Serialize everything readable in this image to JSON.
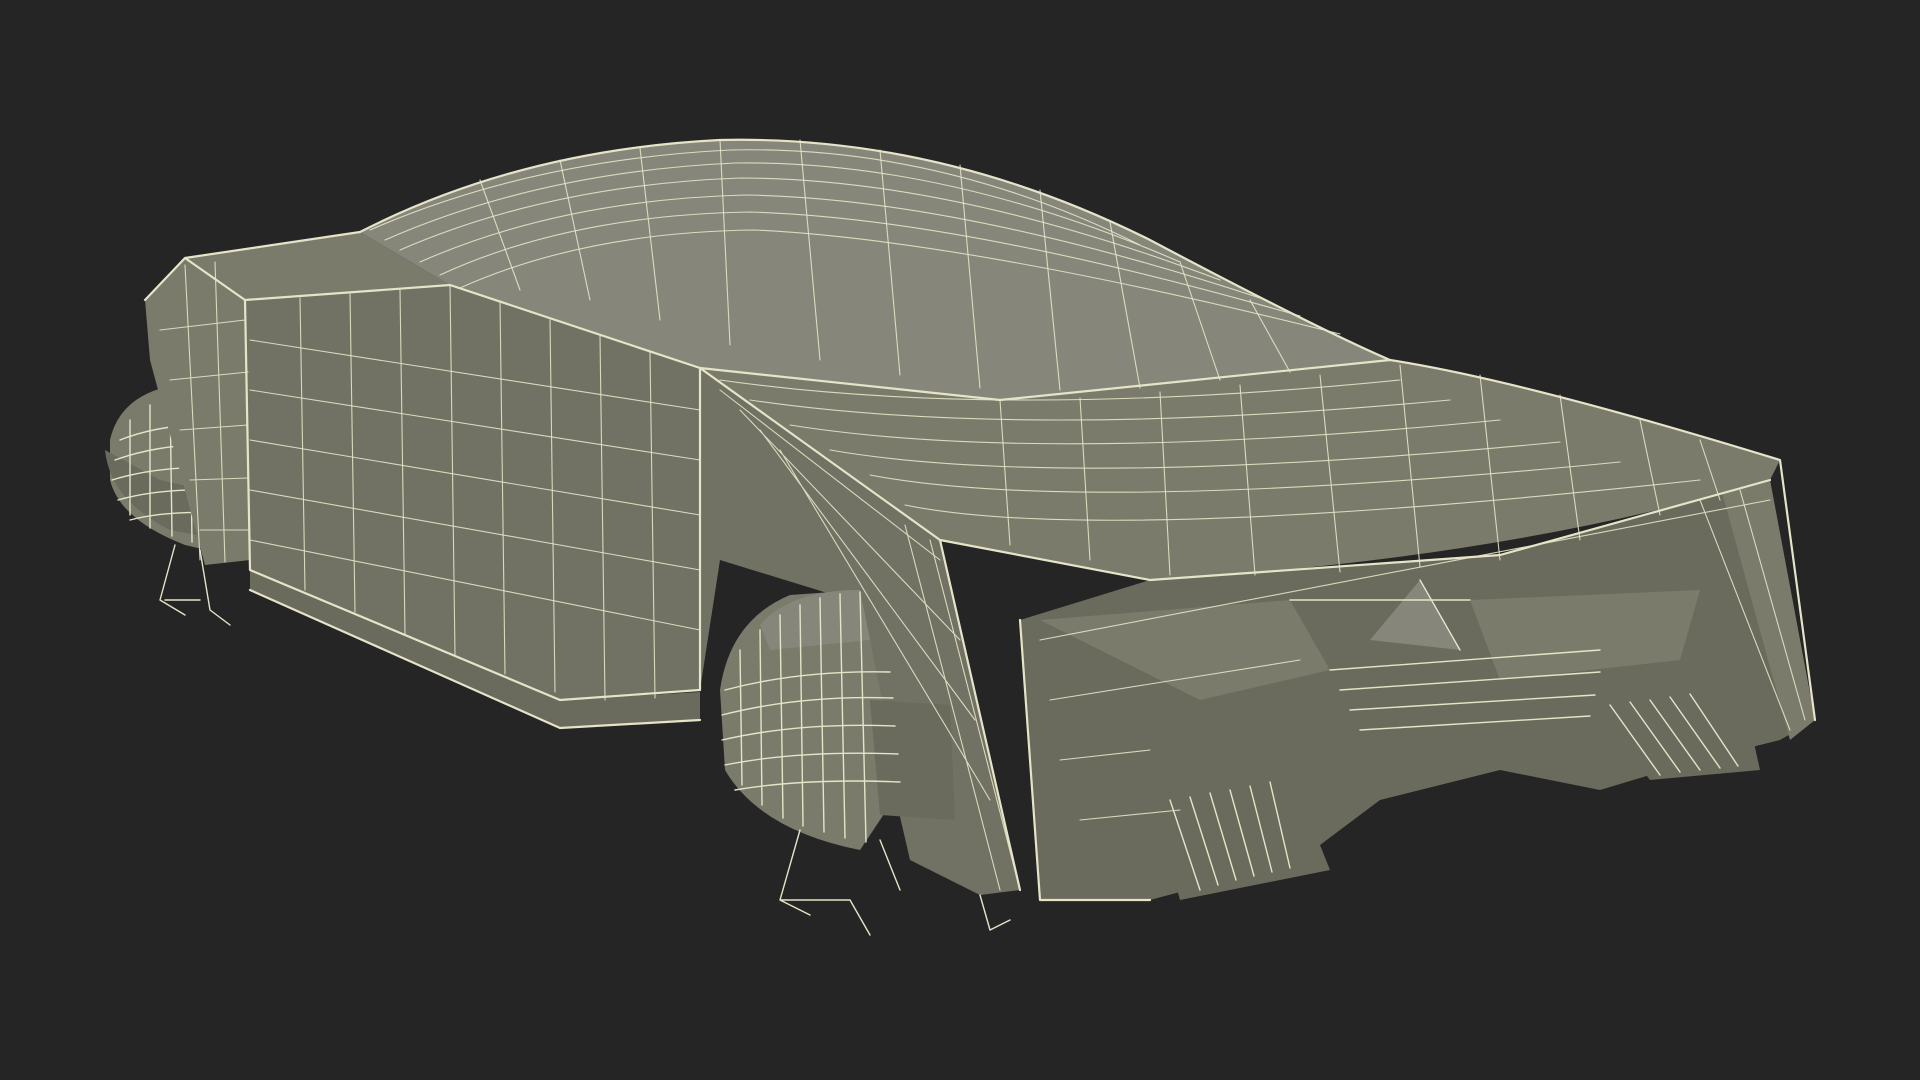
{
  "scene": {
    "subject": "hover-car-wireframe-model",
    "colors": {
      "background": "#252525",
      "surface": "#7a7b6b",
      "surface_shadow": "#6a6b5c",
      "surface_light": "#86877a",
      "wire": "#e6e4c8"
    }
  }
}
